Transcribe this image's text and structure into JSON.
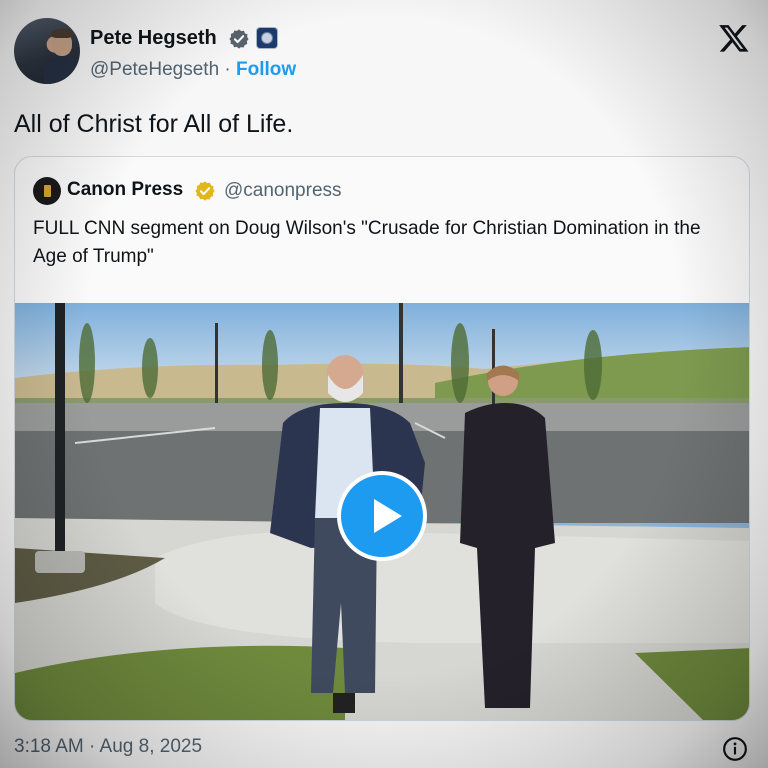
{
  "author": {
    "name": "Pete Hegseth",
    "handle": "@PeteHegseth",
    "separator": "·",
    "follow_label": "Follow",
    "avatar_icon": "person-avatar",
    "verified_icon": "verified-check-icon",
    "org_icon": "government-seal-icon"
  },
  "platform_icon": "x-logo-icon",
  "tweet": {
    "text": "All of Christ for All of Life."
  },
  "quoted_tweet": {
    "author_name": "Canon Press",
    "author_handle": "@canonpress",
    "verified_icon": "gold-verified-check-icon",
    "text": "FULL CNN segment on Doug Wilson's \"Crusade for Christian Domination in the Age of Trump\"",
    "media": {
      "type": "video",
      "play_icon": "play-icon"
    }
  },
  "footer": {
    "timestamp": "3:18 AM · Aug 8, 2025",
    "info_icon": "info-icon"
  },
  "colors": {
    "accent": "#1d9bf0",
    "text_primary": "#0f1419",
    "text_secondary": "#536471",
    "gold_badge": "#e2b719"
  }
}
